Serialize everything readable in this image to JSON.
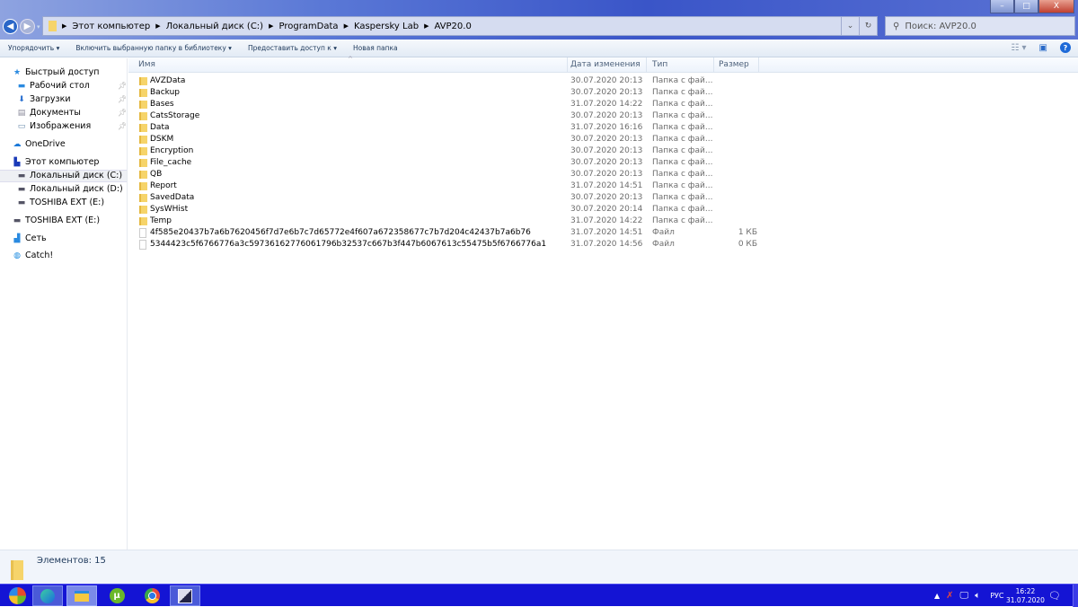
{
  "window": {
    "minimize": "–",
    "maximize": "□",
    "close": "X"
  },
  "address": {
    "crumbs": [
      "Этот компьютер",
      "Локальный диск (C:)",
      "ProgramData",
      "Kaspersky Lab",
      "AVP20.0"
    ]
  },
  "search": {
    "placeholder": "Поиск: AVP20.0"
  },
  "toolbar": {
    "organize": "Упорядочить ▾",
    "include": "Включить выбранную папку в библиотеку ▾",
    "share": "Предоставить доступ к ▾",
    "new_folder": "Новая папка"
  },
  "sidebar": {
    "quick_access": "Быстрый доступ",
    "desktop": "Рабочий стол",
    "downloads": "Загрузки",
    "documents": "Документы",
    "pictures": "Изображения",
    "onedrive": "OneDrive",
    "this_pc": "Этот компьютер",
    "disk_c": "Локальный диск (C:)",
    "disk_d": "Локальный диск (D:)",
    "disk_e": "TOSHIBA EXT (E:)",
    "ext_e": "TOSHIBA EXT (E:)",
    "network": "Сеть",
    "catch": "Catch!"
  },
  "columns": {
    "name": "Имя",
    "date": "Дата изменения",
    "type": "Тип",
    "size": "Размер"
  },
  "files": [
    {
      "name": "AVZData",
      "date": "30.07.2020 20:13",
      "type": "Папка с фай...",
      "size": "",
      "kind": "folder"
    },
    {
      "name": "Backup",
      "date": "30.07.2020 20:13",
      "type": "Папка с фай...",
      "size": "",
      "kind": "folder"
    },
    {
      "name": "Bases",
      "date": "31.07.2020 14:22",
      "type": "Папка с фай...",
      "size": "",
      "kind": "folder"
    },
    {
      "name": "CatsStorage",
      "date": "30.07.2020 20:13",
      "type": "Папка с фай...",
      "size": "",
      "kind": "folder"
    },
    {
      "name": "Data",
      "date": "31.07.2020 16:16",
      "type": "Папка с фай...",
      "size": "",
      "kind": "folder"
    },
    {
      "name": "DSKM",
      "date": "30.07.2020 20:13",
      "type": "Папка с фай...",
      "size": "",
      "kind": "folder"
    },
    {
      "name": "Encryption",
      "date": "30.07.2020 20:13",
      "type": "Папка с фай...",
      "size": "",
      "kind": "folder"
    },
    {
      "name": "File_cache",
      "date": "30.07.2020 20:13",
      "type": "Папка с фай...",
      "size": "",
      "kind": "folder"
    },
    {
      "name": "QB",
      "date": "30.07.2020 20:13",
      "type": "Папка с фай...",
      "size": "",
      "kind": "folder"
    },
    {
      "name": "Report",
      "date": "31.07.2020 14:51",
      "type": "Папка с фай...",
      "size": "",
      "kind": "folder"
    },
    {
      "name": "SavedData",
      "date": "30.07.2020 20:13",
      "type": "Папка с фай...",
      "size": "",
      "kind": "folder"
    },
    {
      "name": "SysWHist",
      "date": "30.07.2020 20:14",
      "type": "Папка с фай...",
      "size": "",
      "kind": "folder"
    },
    {
      "name": "Temp",
      "date": "31.07.2020 14:22",
      "type": "Папка с фай...",
      "size": "",
      "kind": "folder"
    },
    {
      "name": "4f585e20437b7a6b7620456f7d7e6b7c7d65772e4f607a672358677c7b7d204c42437b7a6b76",
      "date": "31.07.2020 14:51",
      "type": "Файл",
      "size": "1 КБ",
      "kind": "file"
    },
    {
      "name": "5344423c5f6766776a3c59736162776061796b32537c667b3f447b6067613c55475b5f6766776a1",
      "date": "31.07.2020 14:56",
      "type": "Файл",
      "size": "0 КБ",
      "kind": "file"
    }
  ],
  "status": {
    "count": "Элементов: 15"
  },
  "tray": {
    "lang": "РУС",
    "time": "16:22",
    "date": "31.07.2020"
  }
}
